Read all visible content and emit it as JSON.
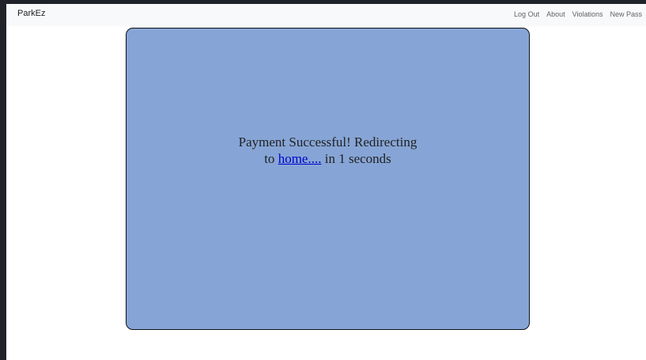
{
  "navbar": {
    "brand": "ParkEz",
    "links": [
      "Log Out",
      "About",
      "Violations",
      "New Pass"
    ]
  },
  "card": {
    "line1": "Payment Successful! Redirecting",
    "prefix": "to ",
    "link_text": "home....",
    "suffix_pre": " in ",
    "seconds": "1",
    "suffix_post": " seconds"
  },
  "colors": {
    "window_bg": "#1f2329",
    "navbar_bg": "#f8f9fa",
    "card_bg": "#86a5d6",
    "link": "#0000cc"
  }
}
